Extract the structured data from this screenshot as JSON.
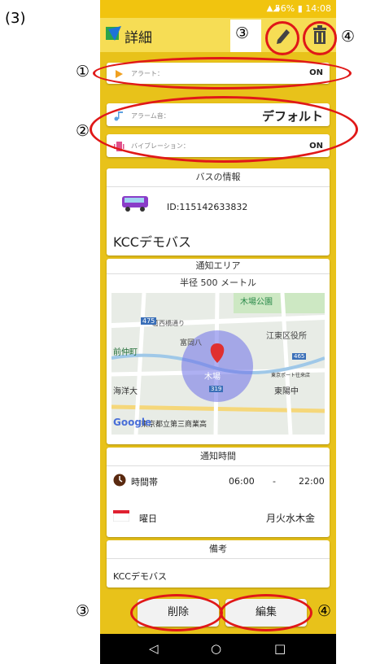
{
  "figure_label": "(3)",
  "status_bar": {
    "battery": "56%",
    "time": "14:08"
  },
  "app_bar": {
    "title": "詳細"
  },
  "alert_row": {
    "label": "アラート：",
    "value": "ON"
  },
  "sound_row": {
    "label": "アラーム音：",
    "value": "デフォルト"
  },
  "vibration_row": {
    "label": "バイブレーション：",
    "value": "ON"
  },
  "bus_info": {
    "header": "バスの情報",
    "id_text": "ID:115142633832",
    "name": "KCCデモバス"
  },
  "area": {
    "header": "通知エリア",
    "radius_label": "半径 500 メートル",
    "map_labels": {
      "park": "木場公園",
      "road": "葛西橋通り",
      "koto": "江東区役所",
      "monzen": "前仲町",
      "kiba": "木場",
      "toyocho": "東陽中",
      "koto_center": "東京ポート往来店",
      "highschool": "東京都立第三商業高",
      "tomioka": "富岡八",
      "yo": "海洋大",
      "route475": "475",
      "route319": "319",
      "route465": "465",
      "google": "Google"
    }
  },
  "notify_time": {
    "header": "通知時間",
    "time_label": "時間帯",
    "start": "06:00",
    "dash": "-",
    "end": "22:00",
    "day_label": "曜日",
    "days": "月火水木金"
  },
  "remarks": {
    "header": "備考",
    "text": "KCCデモバス"
  },
  "buttons": {
    "delete": "削除",
    "edit": "編集"
  },
  "annotations": {
    "one": "①",
    "two": "②",
    "three_top": "③",
    "four_top": "④",
    "three_bottom": "③",
    "four_bottom": "④"
  },
  "colors": {
    "accent_yellow": "#f1c40f",
    "ring_red": "#e01818",
    "map_circle": "#6b6fe8"
  },
  "icons": {
    "back": "◁",
    "home": "○",
    "recent": "□"
  }
}
